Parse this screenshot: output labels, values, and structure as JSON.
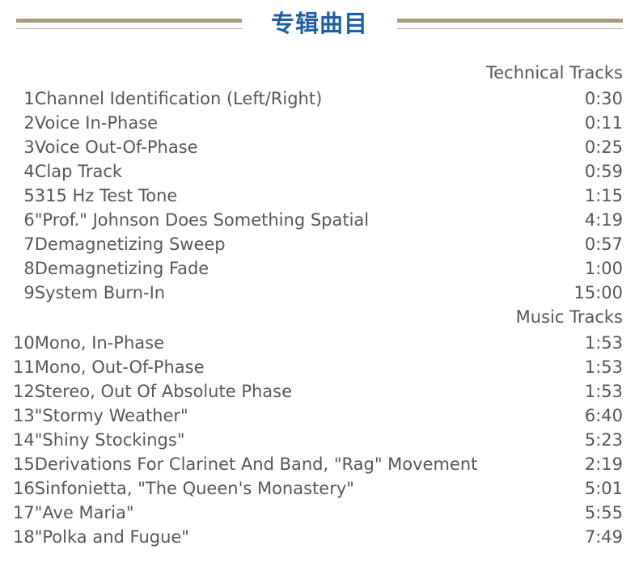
{
  "header": {
    "title": "专辑曲目",
    "rule_color": "#a99a84",
    "title_color": "#1f5fa0"
  },
  "sections": [
    {
      "label": "Technical Tracks"
    },
    {
      "label": "Music Tracks"
    }
  ],
  "tracks": [
    {
      "num": "1",
      "title": "Channel Identification (Left/Right)",
      "time": "0:30"
    },
    {
      "num": "2",
      "title": "Voice In-Phase",
      "time": "0:11"
    },
    {
      "num": "3",
      "title": "Voice Out-Of-Phase",
      "time": "0:25"
    },
    {
      "num": "4",
      "title": "Clap Track",
      "time": "0:59"
    },
    {
      "num": "5",
      "title": "315 Hz Test Tone",
      "time": "1:15"
    },
    {
      "num": "6",
      "title": "\"Prof.\" Johnson Does Something Spatial",
      "time": "4:19"
    },
    {
      "num": "7",
      "title": "Demagnetizing Sweep",
      "time": "0:57"
    },
    {
      "num": "8",
      "title": "Demagnetizing Fade",
      "time": "1:00"
    },
    {
      "num": "9",
      "title": "System Burn-In",
      "time": "15:00"
    },
    {
      "num": "10",
      "title": "Mono, In-Phase",
      "time": "1:53"
    },
    {
      "num": "11",
      "title": "Mono, Out-Of-Phase",
      "time": "1:53"
    },
    {
      "num": "12",
      "title": "Stereo, Out Of Absolute Phase",
      "time": "1:53"
    },
    {
      "num": "13",
      "title": "\"Stormy Weather\"",
      "time": "6:40"
    },
    {
      "num": "14",
      "title": "\"Shiny Stockings\"",
      "time": "5:23"
    },
    {
      "num": "15",
      "title": "Derivations For Clarinet And Band, \"Rag\" Movement",
      "time": "2:19"
    },
    {
      "num": "16",
      "title": "Sinfonietta, \"The Queen's Monastery\"",
      "time": "5:01"
    },
    {
      "num": "17",
      "title": "\"Ave Maria\"",
      "time": "5:55"
    },
    {
      "num": "18",
      "title": "\"Polka and Fugue\"",
      "time": "7:49"
    }
  ]
}
